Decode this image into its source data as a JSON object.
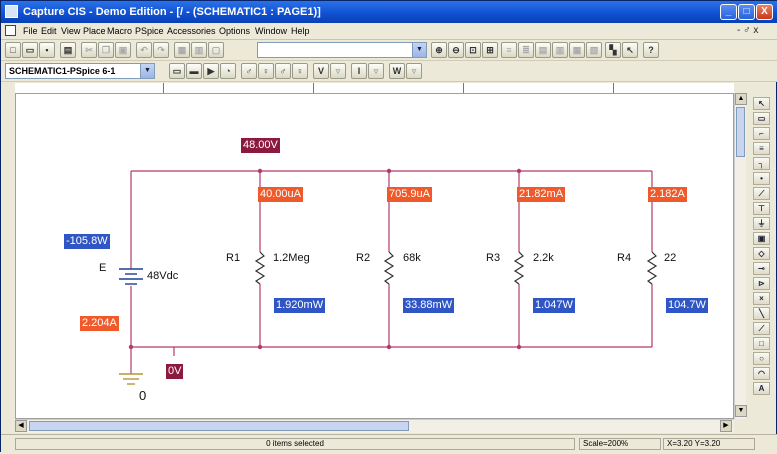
{
  "window": {
    "title": "Capture CIS - Demo Edition - [/ - (SCHEMATIC1 : PAGE1)]"
  },
  "window_controls": {
    "minimize": "_",
    "maximize": "□",
    "close": "X"
  },
  "menu": {
    "items": [
      "File",
      "Edit",
      "View",
      "Place",
      "Macro",
      "PSpice",
      "Accessories",
      "Options",
      "Window",
      "Help"
    ],
    "mdi_controls": "- ♂ x"
  },
  "toolbar": {
    "part_combo_value": "",
    "profile_combo_value": "SCHEMATIC1-PSpice 6-1",
    "marker_labels": {
      "v": "V",
      "i": "I",
      "w": "W"
    }
  },
  "schematic": {
    "labels": {
      "node_voltage_top": "48.00V",
      "node_voltage_bottom": "0V",
      "source_power": "-105.8W",
      "source_current": "2.204A",
      "r1_current": "40.00uA",
      "r2_current": "705.9uA",
      "r3_current": "21.82mA",
      "r4_current": "2.182A",
      "r1_power": "1.920mW",
      "r2_power": "33.88mW",
      "r3_power": "1.047W",
      "r4_power": "104.7W"
    },
    "components": {
      "source_name": "E",
      "source_value": "48Vdc",
      "r1_name": "R1",
      "r1_value": "1.2Meg",
      "r2_name": "R2",
      "r2_value": "68k",
      "r3_name": "R3",
      "r3_value": "2.2k",
      "r4_name": "R4",
      "r4_value": "22",
      "ground_label": "0"
    },
    "colors": {
      "wire": "#b33a6a",
      "voltage_label": "#8b1a3e",
      "current_label": "#f05a2a",
      "power_label": "#2f56c4"
    }
  },
  "status": {
    "message": "0 items selected",
    "scale": "Scale=200%",
    "coords": "X=3.20  Y=3.20"
  }
}
